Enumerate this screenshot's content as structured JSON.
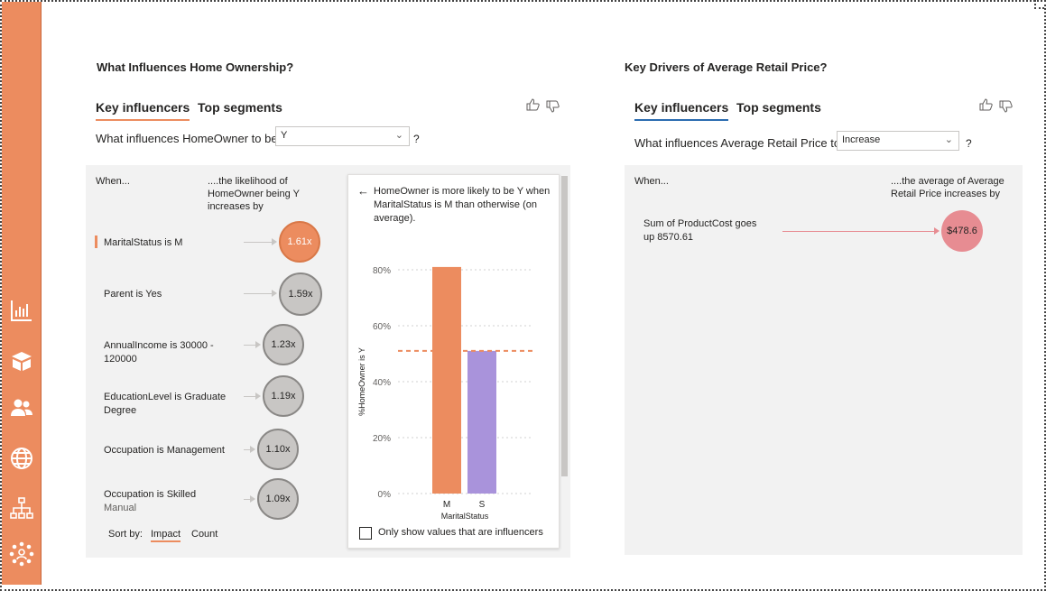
{
  "sidebar": {
    "icons": [
      "bar-chart-icon",
      "box-icon",
      "users-icon",
      "globe-icon",
      "hierarchy-icon",
      "network-person-icon"
    ]
  },
  "left": {
    "title": "What Influences Home Ownership?",
    "tabs": {
      "key_influencers": "Key influencers",
      "top_segments": "Top segments"
    },
    "question": "What influences HomeOwner to be",
    "dropdown_value": "Y",
    "qmark": "?",
    "col_when": "When...",
    "col_likelihood": "....the likelihood of HomeOwner being Y increases by",
    "influencers": [
      {
        "label": "MaritalStatus is M",
        "sub": "",
        "value": "1.61x",
        "selected": true
      },
      {
        "label": "Parent is Yes",
        "sub": "",
        "value": "1.59x",
        "selected": false
      },
      {
        "label": "AnnualIncome is 30000 - 120000",
        "sub": "",
        "value": "1.23x",
        "selected": false
      },
      {
        "label": "EducationLevel is Graduate Degree",
        "sub": "",
        "value": "1.19x",
        "selected": false
      },
      {
        "label": "Occupation is Management",
        "sub": "",
        "value": "1.10x",
        "selected": false
      },
      {
        "label": "Occupation is Skilled",
        "sub": "Manual",
        "value": "1.09x",
        "selected": false
      }
    ],
    "sort_by": "Sort by:",
    "sort_impact": "Impact",
    "sort_count": "Count",
    "detail": {
      "header": "HomeOwner is more likely to be Y when MaritalStatus is M than otherwise (on average).",
      "checkbox_label": "Only show values that are influencers"
    }
  },
  "right": {
    "title": "Key Drivers of Average Retail Price?",
    "tabs": {
      "key_influencers": "Key influencers",
      "top_segments": "Top segments"
    },
    "question": "What influences Average Retail Price to",
    "dropdown_value": "Increase",
    "qmark": "?",
    "col_when": "When...",
    "col_average": "....the average of Average Retail Price increases by",
    "influencer": {
      "label": "Sum of ProductCost goes up 8570.61",
      "value": "$478.6"
    }
  },
  "colors": {
    "accent_orange": "#ec8c5f",
    "bar_purple": "#a993db",
    "bubble_pink": "#e78c92",
    "tab_blue": "#2b6cb0"
  },
  "chart_data": {
    "type": "bar",
    "categories": [
      "M",
      "S"
    ],
    "values": [
      81,
      51
    ],
    "reference_line": 51,
    "xlabel": "MaritalStatus",
    "ylabel": "%HomeOwner is Y",
    "ylim": [
      0,
      80
    ],
    "yticks": [
      "0%",
      "20%",
      "40%",
      "60%",
      "80%"
    ],
    "colors": [
      "#ec8c5f",
      "#a993db"
    ]
  }
}
